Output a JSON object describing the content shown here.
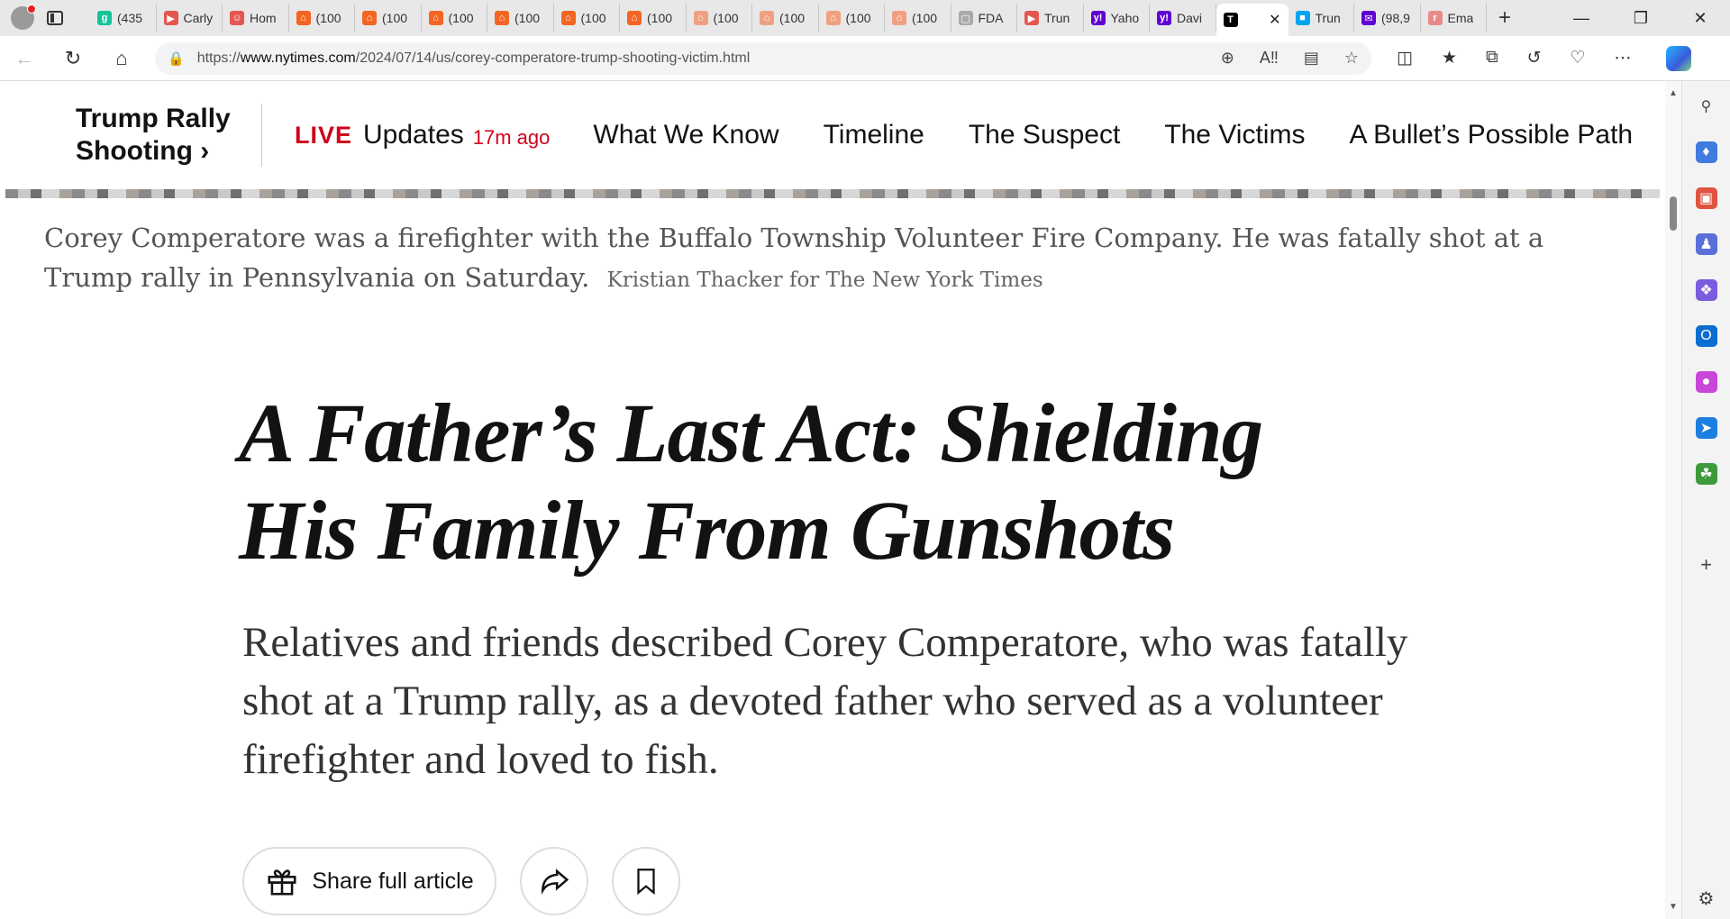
{
  "browser": {
    "tabs": [
      {
        "label": "(435",
        "fav": "g",
        "color": "#15c39a"
      },
      {
        "label": "Carly",
        "fav": "▶",
        "color": "#e4574f"
      },
      {
        "label": "Hom",
        "fav": "☺",
        "color": "#e4574f"
      },
      {
        "label": "(100",
        "fav": "⌂",
        "color": "#f26522"
      },
      {
        "label": "(100",
        "fav": "⌂",
        "color": "#f26522"
      },
      {
        "label": "(100",
        "fav": "⌂",
        "color": "#f26522"
      },
      {
        "label": "(100",
        "fav": "⌂",
        "color": "#f26522"
      },
      {
        "label": "(100",
        "fav": "⌂",
        "color": "#f26522"
      },
      {
        "label": "(100",
        "fav": "⌂",
        "color": "#f26522"
      },
      {
        "label": "(100",
        "fav": "⌂",
        "color": "#f0a080"
      },
      {
        "label": "(100",
        "fav": "⌂",
        "color": "#f0a080"
      },
      {
        "label": "(100",
        "fav": "⌂",
        "color": "#f0a080"
      },
      {
        "label": "(100",
        "fav": "⌂",
        "color": "#f0a080"
      },
      {
        "label": "FDA",
        "fav": "▢",
        "color": "#aaaaaa"
      },
      {
        "label": "Trun",
        "fav": "▶",
        "color": "#e4574f"
      },
      {
        "label": "Yaho",
        "fav": "y!",
        "color": "#6001d2"
      },
      {
        "label": "Davi",
        "fav": "y!",
        "color": "#6001d2"
      },
      {
        "label": "",
        "fav": "T",
        "color": "#000000",
        "active": true
      },
      {
        "label": "Trun",
        "fav": "■",
        "color": "#00a4ef"
      },
      {
        "label": "(98,9",
        "fav": "✉",
        "color": "#6001d2"
      },
      {
        "label": "Ema",
        "fav": "r",
        "color": "#e88a8a"
      }
    ],
    "active_close": "✕",
    "new_tab": "+",
    "url_scheme": "https://",
    "url_host": "www.nytimes.com",
    "url_path": "/2024/07/14/us/corey-comperatore-trump-shooting-victim.html"
  },
  "subnav": {
    "title_line1": "Trump Rally",
    "title_line2": "Shooting ›",
    "live": "LIVE",
    "updates": "Updates",
    "ago": "17m ago",
    "links": [
      "What We Know",
      "Timeline",
      "The Suspect",
      "The Victims",
      "A Bullet’s Possible Path"
    ]
  },
  "caption": {
    "text": "Corey Comperatore was a firefighter with the Buffalo Township Volunteer Fire Company. He was fatally shot at a Trump rally in Pennsylvania on Saturday.",
    "credit": "Kristian Thacker for The New York Times"
  },
  "article": {
    "headline_line1": "A Father’s Last Act: Shielding",
    "headline_line2": "His Family From Gunshots",
    "summary": "Relatives and friends described Corey Comperatore, who was fatally shot at a Trump rally, as a devoted father who served as a volunteer firefighter and loved to fish.",
    "share_label": "Share full article"
  }
}
